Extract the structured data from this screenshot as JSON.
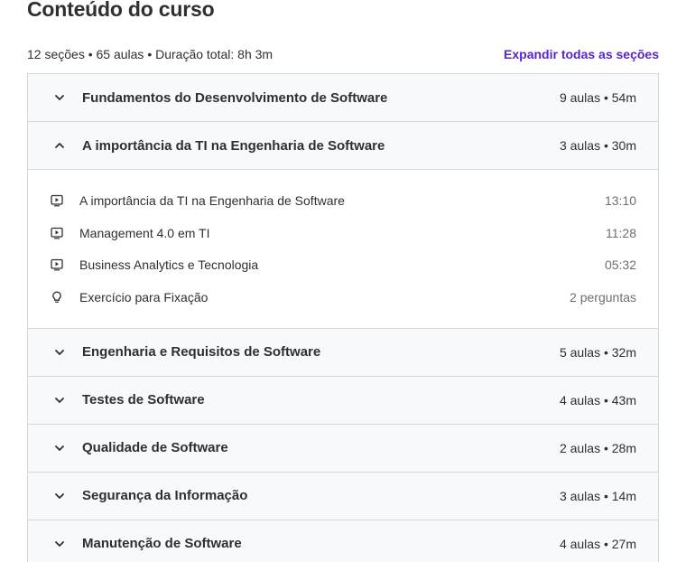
{
  "heading": "Conteúdo do curso",
  "summary": "12 seções • 65 aulas • Duração total: 8h 3m",
  "expand_all_label": "Expandir todas as seções",
  "sections": [
    {
      "title": "Fundamentos do Desenvolvimento de Software",
      "info": "9 aulas • 54m",
      "expanded": false
    },
    {
      "title": "A importância da TI na Engenharia de Software",
      "info": "3 aulas • 30m",
      "expanded": true,
      "lectures": [
        {
          "icon": "video-icon",
          "title": "A importância da TI na Engenharia de Software",
          "duration": "13:10"
        },
        {
          "icon": "video-icon",
          "title": "Management 4.0 em TI",
          "duration": "11:28"
        },
        {
          "icon": "video-icon",
          "title": "Business Analytics e Tecnologia",
          "duration": "05:32"
        },
        {
          "icon": "lightbulb-icon",
          "title": "Exercício para Fixação",
          "duration": "2 perguntas"
        }
      ]
    },
    {
      "title": "Engenharia e Requisitos de Software",
      "info": "5 aulas • 32m",
      "expanded": false
    },
    {
      "title": "Testes de Software",
      "info": "4 aulas • 43m",
      "expanded": false
    },
    {
      "title": "Qualidade de Software",
      "info": "2 aulas • 28m",
      "expanded": false
    },
    {
      "title": "Segurança da Informação",
      "info": "3 aulas • 14m",
      "expanded": false
    },
    {
      "title": "Manutenção de Software",
      "info": "4 aulas • 27m",
      "expanded": false
    }
  ],
  "colors": {
    "accent": "#5624d0",
    "header_bg": "#f7f9fa",
    "border": "#d1d7dc",
    "text": "#2d2f31",
    "muted": "#6a6f73"
  }
}
